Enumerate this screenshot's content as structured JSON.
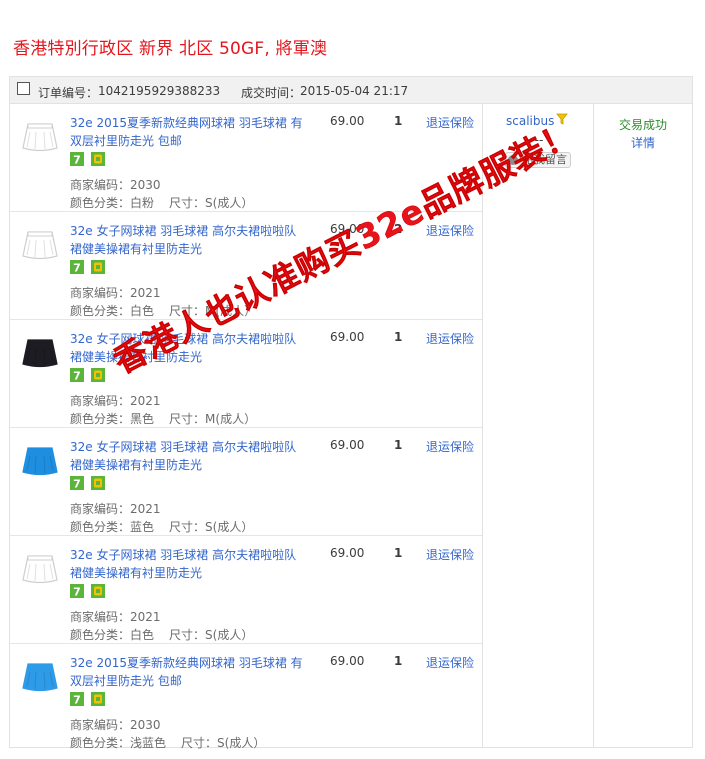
{
  "header": {
    "location": "香港特別行政区 新界 北区 50GF, 將軍澳"
  },
  "order": {
    "number_label": "订单编号：",
    "number": "1042195929388233",
    "time_label": "成交时间：",
    "time": "2015-05-04 21:17"
  },
  "items": [
    {
      "title": "32e 2015夏季新款经典网球裙 羽毛球裙 有双层衬里防走光 包邮",
      "code_label": "商家编码：",
      "code": "2030",
      "color_label": "颜色分类：",
      "color": "白粉",
      "size_label": "尺寸：",
      "size": "S(成人）",
      "price": "69.00",
      "qty": "1",
      "insurance": "退运保险",
      "thumb_color": "#ffffff"
    },
    {
      "title": "32e 女子网球裙 羽毛球裙 高尔夫裙啦啦队裙健美操裙有衬里防走光",
      "code_label": "商家编码：",
      "code": "2021",
      "color_label": "颜色分类：",
      "color": "白色",
      "size_label": "尺寸：",
      "size": "M(成人）",
      "price": "69.00",
      "qty": "2",
      "insurance": "退运保险",
      "thumb_color": "#ffffff"
    },
    {
      "title": "32e 女子网球裙 羽毛球裙 高尔夫裙啦啦队裙健美操裙有衬里防走光",
      "code_label": "商家编码：",
      "code": "2021",
      "color_label": "颜色分类：",
      "color": "黑色",
      "size_label": "尺寸：",
      "size": "M(成人）",
      "price": "69.00",
      "qty": "1",
      "insurance": "退运保险",
      "thumb_color": "#1c1c22"
    },
    {
      "title": "32e 女子网球裙 羽毛球裙 高尔夫裙啦啦队裙健美操裙有衬里防走光",
      "code_label": "商家编码：",
      "code": "2021",
      "color_label": "颜色分类：",
      "color": "蓝色",
      "size_label": "尺寸：",
      "size": "S(成人）",
      "price": "69.00",
      "qty": "1",
      "insurance": "退运保险",
      "thumb_color": "#1e8fe0"
    },
    {
      "title": "32e 女子网球裙 羽毛球裙 高尔夫裙啦啦队裙健美操裙有衬里防走光",
      "code_label": "商家编码：",
      "code": "2021",
      "color_label": "颜色分类：",
      "color": "白色",
      "size_label": "尺寸：",
      "size": "S(成人）",
      "price": "69.00",
      "qty": "1",
      "insurance": "退运保险",
      "thumb_color": "#ffffff"
    },
    {
      "title": "32e 2015夏季新款经典网球裙 羽毛球裙 有双层衬里防走光 包邮",
      "code_label": "商家编码：",
      "code": "2030",
      "color_label": "颜色分类：",
      "color": "浅蓝色",
      "size_label": "尺寸：",
      "size": "S(成人）",
      "price": "69.00",
      "qty": "1",
      "insurance": "退运保险",
      "thumb_color": "#2e9be8"
    }
  ],
  "buyer": {
    "name": "scalibus",
    "dash": "----",
    "message_button": "给我留言",
    "filter_icon": "filter-icon"
  },
  "status": {
    "text": "交易成功",
    "details": "详情"
  },
  "watermark": {
    "text": "香港人也认准购买32e品牌服装！"
  },
  "colors": {
    "header_red": "#e4161d",
    "link_blue": "#3366cc",
    "status_green": "#2e8b2e",
    "badge_green": "#5bb53a",
    "badge_yellow": "#f2c200"
  }
}
